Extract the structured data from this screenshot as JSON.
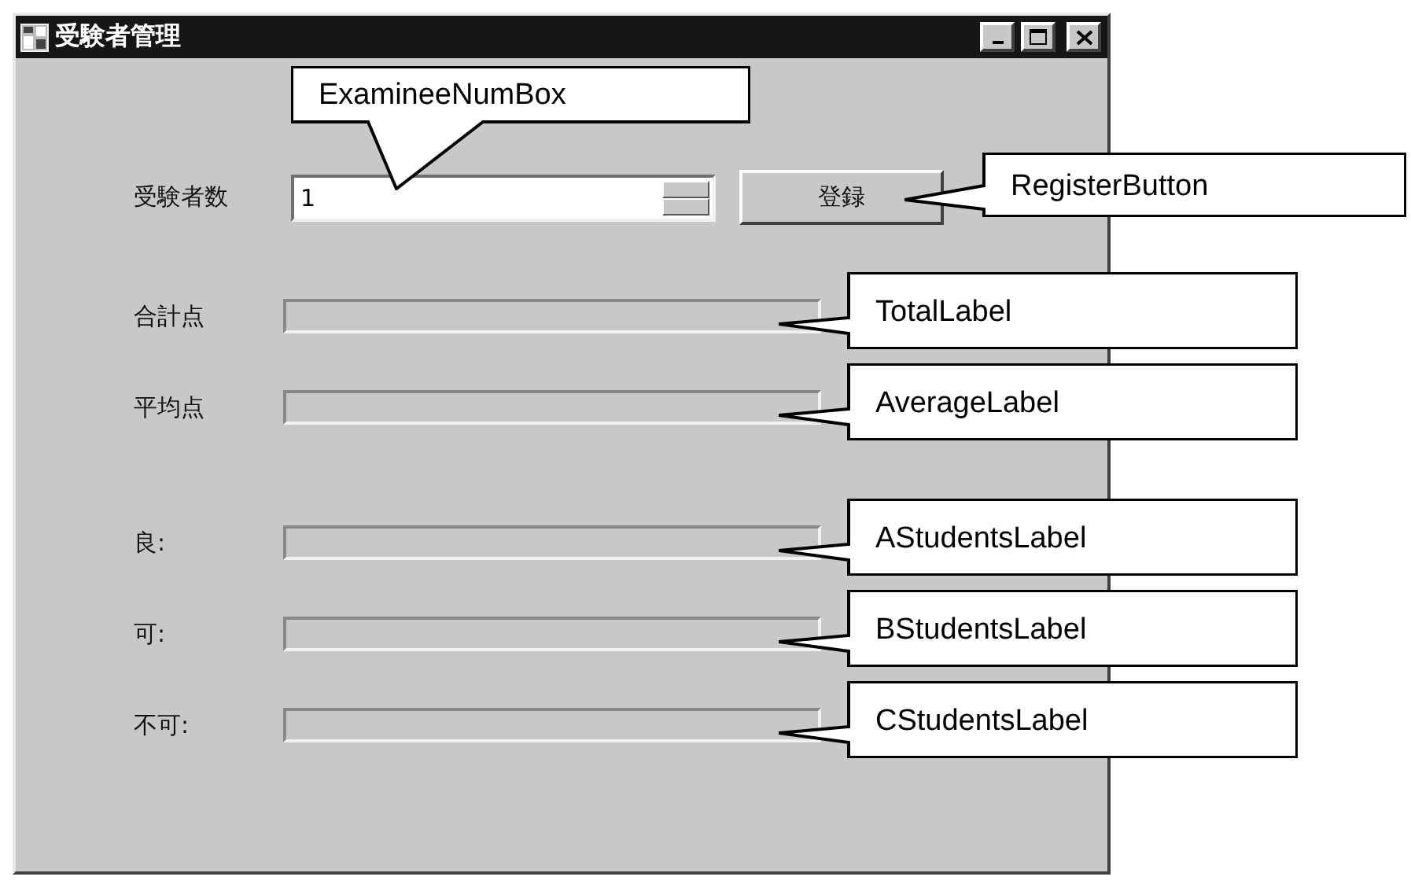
{
  "window": {
    "title": "受験者管理"
  },
  "examinee": {
    "label": "受験者数",
    "value": "1",
    "button": "登録"
  },
  "totals": [
    {
      "label": "合計点"
    },
    {
      "label": "平均点"
    }
  ],
  "grades": [
    {
      "label": "良:"
    },
    {
      "label": "可:"
    },
    {
      "label": "不可:"
    }
  ],
  "callouts": [
    {
      "text": "ExamineeNumBox"
    },
    {
      "text": "RegisterButton"
    },
    {
      "text": "TotalLabel"
    },
    {
      "text": "AverageLabel"
    },
    {
      "text": "AStudentsLabel"
    },
    {
      "text": "BStudentsLabel"
    },
    {
      "text": "CStudentsLabel"
    }
  ]
}
